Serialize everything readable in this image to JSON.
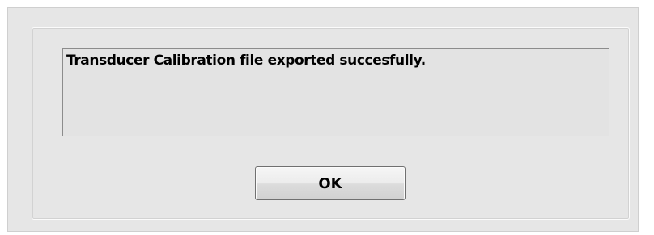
{
  "dialog": {
    "message": "Transducer Calibration file exported succesfully.",
    "ok_label": "OK"
  }
}
